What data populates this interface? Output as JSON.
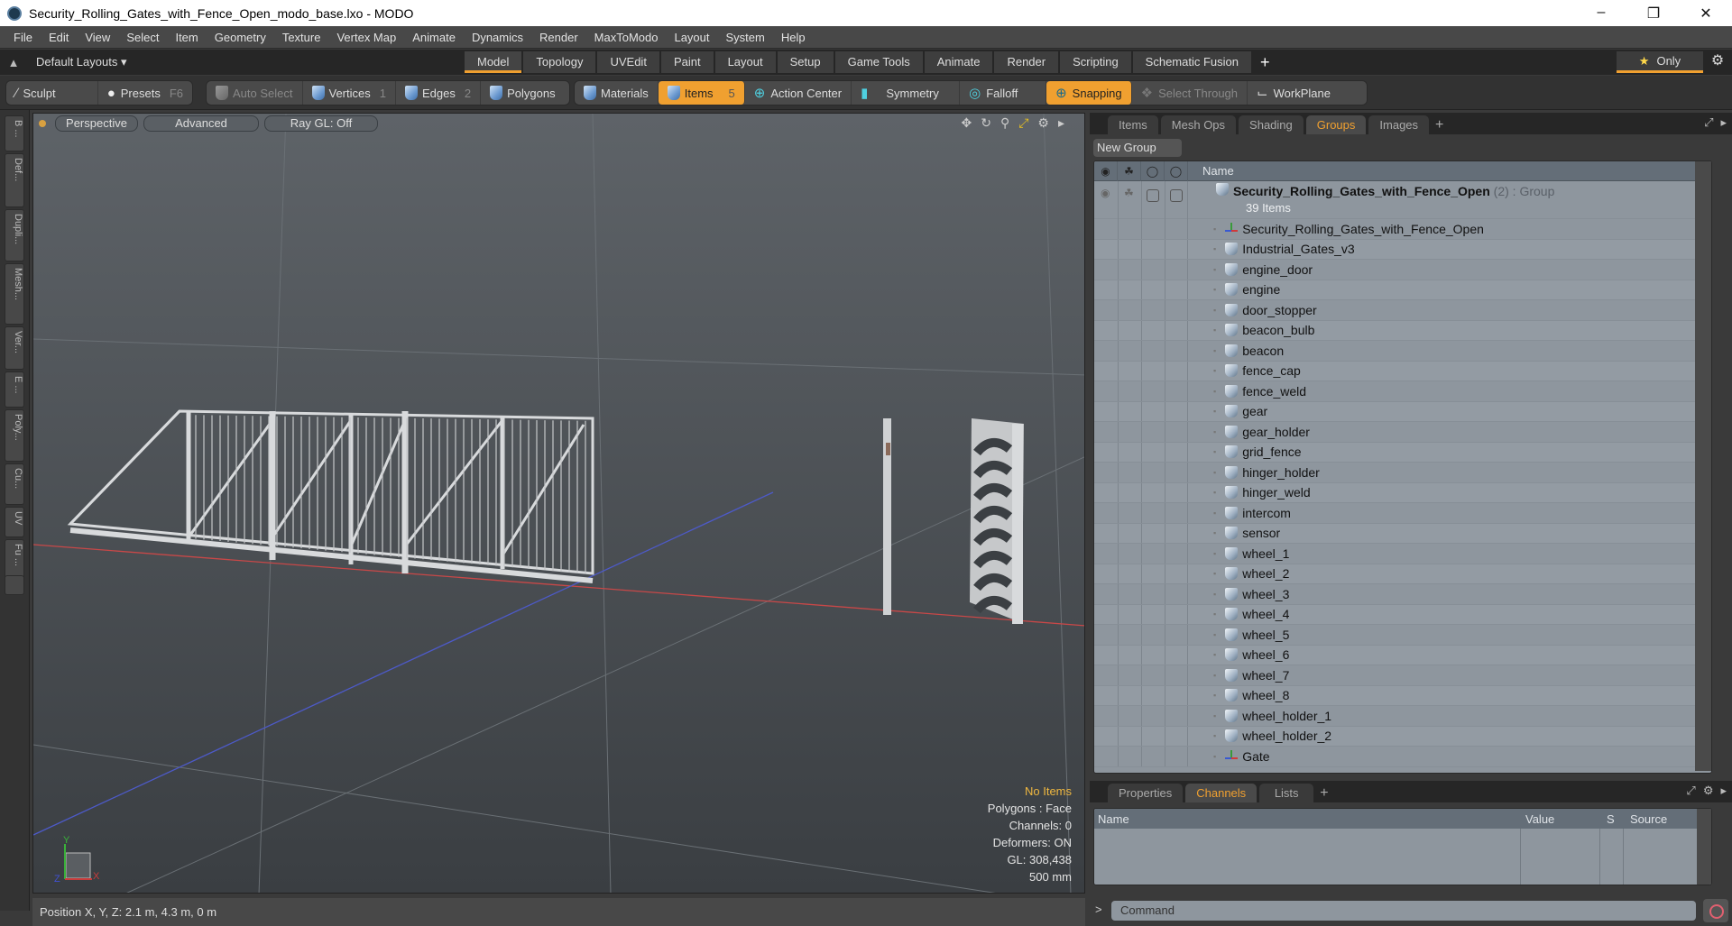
{
  "window": {
    "title": "Security_Rolling_Gates_with_Fence_Open_modo_base.lxo - MODO",
    "controls": [
      "minimize",
      "restore",
      "close"
    ]
  },
  "menu": [
    "File",
    "Edit",
    "View",
    "Select",
    "Item",
    "Geometry",
    "Texture",
    "Vertex Map",
    "Animate",
    "Dynamics",
    "Render",
    "MaxToModo",
    "Layout",
    "System",
    "Help"
  ],
  "layoutbar": {
    "layouts_label": "Default Layouts ▾",
    "tabs": [
      "Model",
      "Topology",
      "UVEdit",
      "Paint",
      "Layout",
      "Setup",
      "Game Tools",
      "Animate",
      "Render",
      "Scripting",
      "Schematic Fusion"
    ],
    "active_tab": "Model",
    "plus": "+",
    "only_label": "Only"
  },
  "toolbar": {
    "sculpt": "Sculpt",
    "presets": "Presets",
    "presets_key": "F6",
    "auto_select": "Auto Select",
    "vertices": "Vertices",
    "vertices_key": "1",
    "edges": "Edges",
    "edges_key": "2",
    "polygons": "Polygons",
    "materials": "Materials",
    "items": "Items",
    "items_key": "5",
    "action_center": "Action Center",
    "symmetry": "Symmetry",
    "falloff": "Falloff",
    "snapping": "Snapping",
    "select_through": "Select Through",
    "workplane": "WorkPlane"
  },
  "left_strip": [
    "B ...",
    "Def...",
    "Dupli...",
    "Mesh...",
    "Ver...",
    "E ...",
    "Poly...",
    "Cu...",
    "UV",
    "Fu ..."
  ],
  "viewport": {
    "view_mode": "Perspective",
    "shading": "Advanced",
    "raygl": "Ray GL: Off",
    "info": {
      "selection": "No Items",
      "polygons": "Polygons : Face",
      "channels": "Channels: 0",
      "deformers": "Deformers: ON",
      "gl": "GL: 308,438",
      "grid": "500 mm"
    },
    "axis_labels": {
      "x": "X",
      "y": "Y",
      "z": "Z"
    }
  },
  "statusbar": {
    "position": "Position X, Y, Z:   2.1 m, 4.3 m, 0 m"
  },
  "groups_panel": {
    "tabs": [
      "Items",
      "Mesh Ops",
      "Shading",
      "Groups",
      "Images"
    ],
    "active_tab": "Groups",
    "plus": "+",
    "new_group": "New Group",
    "column_name": "Name",
    "group": {
      "name": "Security_Rolling_Gates_with_Fence_Open",
      "count": "(2)",
      "type": ": Group",
      "subtitle": "39 Items"
    },
    "items": [
      {
        "name": "Security_Rolling_Gates_with_Fence_Open",
        "type": "locator"
      },
      {
        "name": "Industrial_Gates_v3",
        "type": "mesh"
      },
      {
        "name": "engine_door",
        "type": "mesh"
      },
      {
        "name": "engine",
        "type": "mesh"
      },
      {
        "name": "door_stopper",
        "type": "mesh"
      },
      {
        "name": "beacon_bulb",
        "type": "mesh"
      },
      {
        "name": "beacon",
        "type": "mesh"
      },
      {
        "name": "fence_cap",
        "type": "mesh"
      },
      {
        "name": "fence_weld",
        "type": "mesh"
      },
      {
        "name": "gear",
        "type": "mesh"
      },
      {
        "name": "gear_holder",
        "type": "mesh"
      },
      {
        "name": "grid_fence",
        "type": "mesh"
      },
      {
        "name": "hinger_holder",
        "type": "mesh"
      },
      {
        "name": "hinger_weld",
        "type": "mesh"
      },
      {
        "name": "intercom",
        "type": "mesh"
      },
      {
        "name": "sensor",
        "type": "mesh"
      },
      {
        "name": "wheel_1",
        "type": "mesh"
      },
      {
        "name": "wheel_2",
        "type": "mesh"
      },
      {
        "name": "wheel_3",
        "type": "mesh"
      },
      {
        "name": "wheel_4",
        "type": "mesh"
      },
      {
        "name": "wheel_5",
        "type": "mesh"
      },
      {
        "name": "wheel_6",
        "type": "mesh"
      },
      {
        "name": "wheel_7",
        "type": "mesh"
      },
      {
        "name": "wheel_8",
        "type": "mesh"
      },
      {
        "name": "wheel_holder_1",
        "type": "mesh"
      },
      {
        "name": "wheel_holder_2",
        "type": "mesh"
      },
      {
        "name": "Gate",
        "type": "locator"
      }
    ]
  },
  "channels_panel": {
    "tabs": [
      "Properties",
      "Channels",
      "Lists"
    ],
    "active_tab": "Channels",
    "plus": "+",
    "columns": [
      "Name",
      "Value",
      "S",
      "Source"
    ]
  },
  "command": {
    "prompt": ">",
    "placeholder": "Command"
  },
  "colors": {
    "accent": "#f0a030",
    "viewport_bg": "#50555a",
    "x_axis": "#d04040",
    "z_axis": "#4050c0"
  }
}
